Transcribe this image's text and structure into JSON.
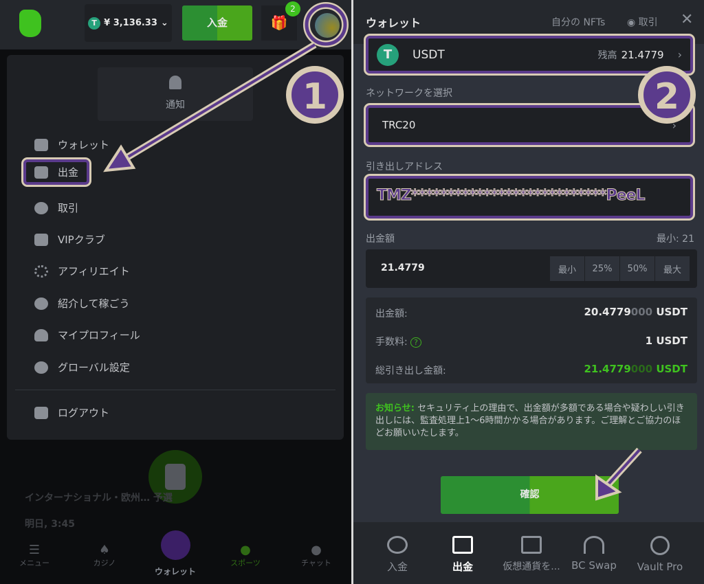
{
  "left": {
    "balance": "¥ 3,136.33",
    "deposit_button": "入金",
    "gift_badge": "2",
    "notification_label": "通知",
    "menu_items": [
      "ウォレット",
      "出金",
      "取引",
      "VIPクラブ",
      "アフィリエイト",
      "紹介して稼ごう",
      "マイプロフィール",
      "グローバル設定"
    ],
    "logout": "ログアウト",
    "bg_match_title": "インターナショナル・欧州… 予選",
    "bg_match_time": "明日, 3:45",
    "bottom_nav": [
      "メニュー",
      "カジノ",
      "ウォレット",
      "スポーツ",
      "チャット"
    ]
  },
  "right": {
    "title": "ウォレット",
    "my_nfts": "自分の NFTs",
    "trade": "取引",
    "currency": "USDT",
    "balance_label": "残高",
    "balance": "21.4779",
    "network_label": "ネットワークを選択",
    "network": "TRC20",
    "address_label": "引き出しアドレス",
    "address": "TMZ***************************PeeL",
    "amount_label": "出金額",
    "min_label": "最小: 21",
    "amount": "21.4779",
    "quick": [
      "最小",
      "25%",
      "50%",
      "最大"
    ],
    "summary": [
      {
        "label": "出金額:",
        "value": "20.4779",
        "dim": "000",
        "unit": "USDT"
      },
      {
        "label": "手数料:",
        "value": "1",
        "dim": "",
        "unit": "USDT"
      },
      {
        "label": "総引き出し金額:",
        "value": "21.4779",
        "dim": "000",
        "unit": "USDT"
      }
    ],
    "notice_title": "お知らせ:",
    "notice_text": "セキュリティ上の理由で、出金額が多額である場合や疑わしい引き出しには、監査処理上1〜6時間かかる場合があります。ご理解とご協力のほどお願いいたします。",
    "confirm": "確認",
    "bottom_nav": [
      "入金",
      "出金",
      "仮想通貨を...",
      "BC Swap",
      "Vault Pro"
    ]
  },
  "annotations": [
    "1",
    "2"
  ],
  "colors": {
    "green": "#3fb21f",
    "purple": "#5b3b8c",
    "beige": "#d8cbb4",
    "usdt": "#26a17b"
  }
}
